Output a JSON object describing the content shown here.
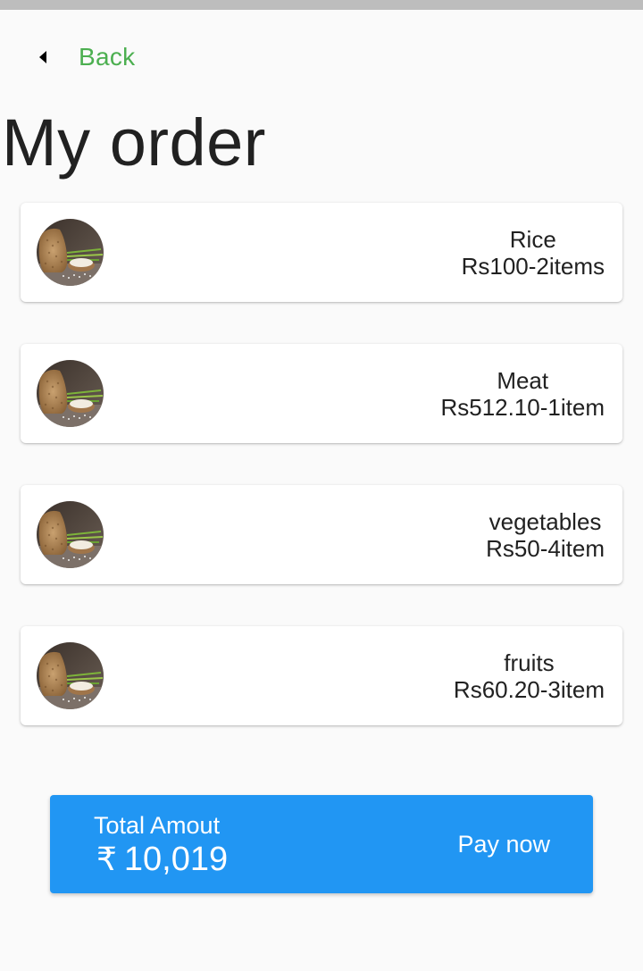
{
  "header": {
    "back_label": "Back",
    "back_icon": "triangle-left-icon",
    "title": "My order"
  },
  "orders": [
    {
      "name": "Rice",
      "detail": "Rs100-2items",
      "image": "grain-sack-photo"
    },
    {
      "name": "Meat",
      "detail": "Rs512.10-1item",
      "image": "grain-sack-photo"
    },
    {
      "name": "vegetables",
      "detail": "Rs50-4item",
      "image": "grain-sack-photo"
    },
    {
      "name": "fruits",
      "detail": "Rs60.20-3item",
      "image": "grain-sack-photo"
    }
  ],
  "total": {
    "label": "Total Amout",
    "currency_symbol": "₹",
    "amount": "10,019",
    "pay_label": "Pay now"
  },
  "colors": {
    "accent_green": "#4caf50",
    "pay_bar_blue": "#2196f3",
    "background": "#fafafa",
    "card": "#ffffff"
  }
}
